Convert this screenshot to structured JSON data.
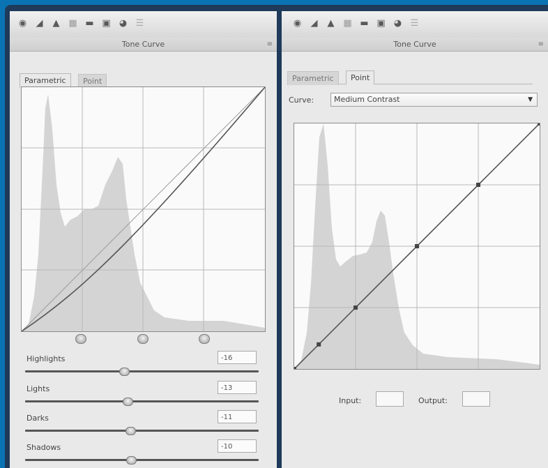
{
  "toolbar_icons": [
    "basic-adjust-icon",
    "tone-curve-icon",
    "detail-icon",
    "hsl-icon",
    "split-toning-icon",
    "lens-corrections-icon",
    "camera-calibration-icon",
    "presets-icon"
  ],
  "left_panel": {
    "title": "Tone Curve",
    "menu_glyph": "≡",
    "tabs": [
      {
        "label": "Parametric",
        "active": true
      },
      {
        "label": "Point",
        "active": false
      }
    ],
    "sliders": [
      {
        "label": "Highlights",
        "value": "-16",
        "level": 0.42
      },
      {
        "label": "Lights",
        "value": "-13",
        "level": 0.44
      },
      {
        "label": "Darks",
        "value": "-11",
        "level": 0.45
      },
      {
        "label": "Shadows",
        "value": "-10",
        "level": 0.45
      }
    ]
  },
  "right_panel": {
    "title": "Tone Curve",
    "menu_glyph": "≡",
    "tabs": [
      {
        "label": "Parametric",
        "active": false
      },
      {
        "label": "Point",
        "active": true
      }
    ],
    "curve_label": "Curve:",
    "curve_value": "Medium Contrast",
    "curve_points": [
      [
        0,
        0
      ],
      [
        0.1,
        0.1
      ],
      [
        0.25,
        0.25
      ],
      [
        0.5,
        0.5
      ],
      [
        0.75,
        0.75
      ],
      [
        1,
        1
      ]
    ],
    "input_label": "Input:",
    "output_label": "Output:"
  },
  "colors": {
    "frame": "#0a73b3",
    "panel": "#e9e9e9",
    "histogram": "#d4d4d4",
    "curve": "#555555"
  }
}
